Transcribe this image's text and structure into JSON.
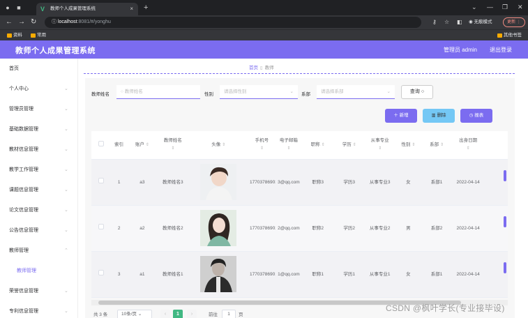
{
  "browser": {
    "tab_title": "教师个人成果管理系统",
    "url_host": "localhost",
    "url_path": ":8081/#/yonghu",
    "incognito_label": "无痕模式",
    "update_label": "更新",
    "bookmarks": [
      "资料",
      "常用"
    ],
    "other_bookmarks": "其他书签"
  },
  "app": {
    "title": "教师个人成果管理系统",
    "admin_label": "管理员 admin",
    "logout_label": "退出登录"
  },
  "sidebar": {
    "items": [
      {
        "label": "首页"
      },
      {
        "label": "个人中心"
      },
      {
        "label": "管理员管理"
      },
      {
        "label": "基础数据管理"
      },
      {
        "label": "教材信息管理"
      },
      {
        "label": "教学工作管理"
      },
      {
        "label": "课题信息管理"
      },
      {
        "label": "论文信息管理"
      },
      {
        "label": "公告信息管理"
      },
      {
        "label": "教师管理"
      },
      {
        "label": "教师管理"
      },
      {
        "label": "荣誉信息管理"
      },
      {
        "label": "专利信息管理"
      }
    ]
  },
  "breadcrumb": {
    "home": "首页",
    "current": "教师"
  },
  "filters": {
    "name_label": "教师姓名",
    "name_placeholder": "教师姓名",
    "gender_label": "性别",
    "gender_placeholder": "请选择性别",
    "dept_label": "系部",
    "dept_placeholder": "请选择系部",
    "query_label": "查询"
  },
  "actions": {
    "add_label": "新增",
    "delete_label": "删除",
    "report_label": "报表"
  },
  "table": {
    "headers": {
      "index": "索引",
      "account": "账户",
      "name": "教师姓名",
      "avatar": "头像",
      "phone": "手机号",
      "email": "电子邮箱",
      "title": "职称",
      "degree": "学历",
      "major": "从事专业",
      "gender": "性别",
      "dept": "系部",
      "birth": "出身日期"
    },
    "rows": [
      {
        "index": "1",
        "account": "a3",
        "name": "教师姓名3",
        "phone": "17703786903",
        "email": "3@qq.com",
        "title": "职称3",
        "degree": "学历3",
        "major": "从事专业3",
        "gender": "女",
        "dept": "系部1",
        "birth": "2022-04-14"
      },
      {
        "index": "2",
        "account": "a2",
        "name": "教师姓名2",
        "phone": "17703786902",
        "email": "2@qq.com",
        "title": "职称2",
        "degree": "学历2",
        "major": "从事专业2",
        "gender": "男",
        "dept": "系部2",
        "birth": "2022-04-14"
      },
      {
        "index": "3",
        "account": "a1",
        "name": "教师姓名1",
        "phone": "17703786901",
        "email": "1@qq.com",
        "title": "职称1",
        "degree": "学历1",
        "major": "从事专业1",
        "gender": "女",
        "dept": "系部1",
        "birth": "2022-04-14"
      }
    ]
  },
  "pagination": {
    "total": "共 3 条",
    "page_size": "10条/页",
    "current_page": "1",
    "goto_label": "前往",
    "goto_value": "1",
    "page_suffix": "页"
  },
  "watermark": "CSDN @枫叶学长(专业接毕设)",
  "colors": {
    "primary": "#7b6cf0",
    "info": "#74c8f5",
    "page_active": "#41b883"
  }
}
